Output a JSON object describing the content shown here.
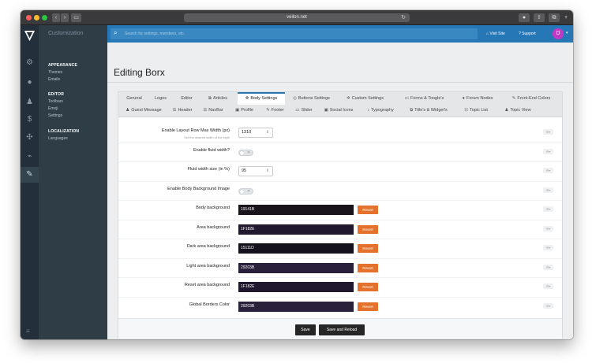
{
  "browser": {
    "url": "veilon.net"
  },
  "sidebar": {
    "heading": "Customization",
    "groups": [
      {
        "title": "APPEARANCE",
        "items": [
          "Themes",
          "Emails"
        ]
      },
      {
        "title": "EDITOR",
        "items": [
          "Toolbars",
          "Emoji",
          "Settings"
        ]
      },
      {
        "title": "LOCALIZATION",
        "items": [
          "Languages"
        ]
      }
    ]
  },
  "topbar": {
    "search_placeholder": "Search for settings, members, etc.",
    "visit_site": "Visit Site",
    "support": "Support",
    "avatar_initial": "D"
  },
  "page": {
    "title": "Editing Borx"
  },
  "tabs_row1": [
    "General",
    "Logos",
    "Editor",
    "Articles",
    "Body Settings",
    "Buttons Settings",
    "Custom Settings",
    "Forms & Toogle's",
    "Forum Nodes",
    "Front-End Colors"
  ],
  "tabs_row2": [
    "Guest Message",
    "Header",
    "NavBar",
    "Profile",
    "Footer",
    "Slider",
    "Social Icons",
    "Typography",
    "Title's & Widget's",
    "Topic List",
    "Topic View"
  ],
  "active_tab": "Body Settings",
  "settings": {
    "max_width_label": "Enable Layout Row Max Width (px)",
    "max_width_hint": "Set the desired width of the style",
    "max_width_value": "1310",
    "fluid_label": "Enable fluid width?",
    "fluid_size_label": "Fluid width size (in %)",
    "fluid_size_value": "95",
    "body_bg_image_label": "Enable Body Background Image",
    "colors": [
      {
        "label": "Body background",
        "value": "19141B",
        "color": "#19141b"
      },
      {
        "label": "Area background",
        "value": "1F182E",
        "color": "#1f182e"
      },
      {
        "label": "Dark area background",
        "value": "15111D",
        "color": "#15111d"
      },
      {
        "label": "Light area background",
        "value": "29203B",
        "color": "#29203b"
      },
      {
        "label": "Reset area background",
        "value": "1F182E",
        "color": "#1f182e"
      },
      {
        "label": "Global Borders Color",
        "value": "29203B",
        "color": "#29203b"
      }
    ],
    "revert_label": "Revert"
  },
  "actions": {
    "save": "Save",
    "save_reload": "Save and Reload"
  },
  "accent": "#2577b5",
  "revert_color": "#e4722c"
}
